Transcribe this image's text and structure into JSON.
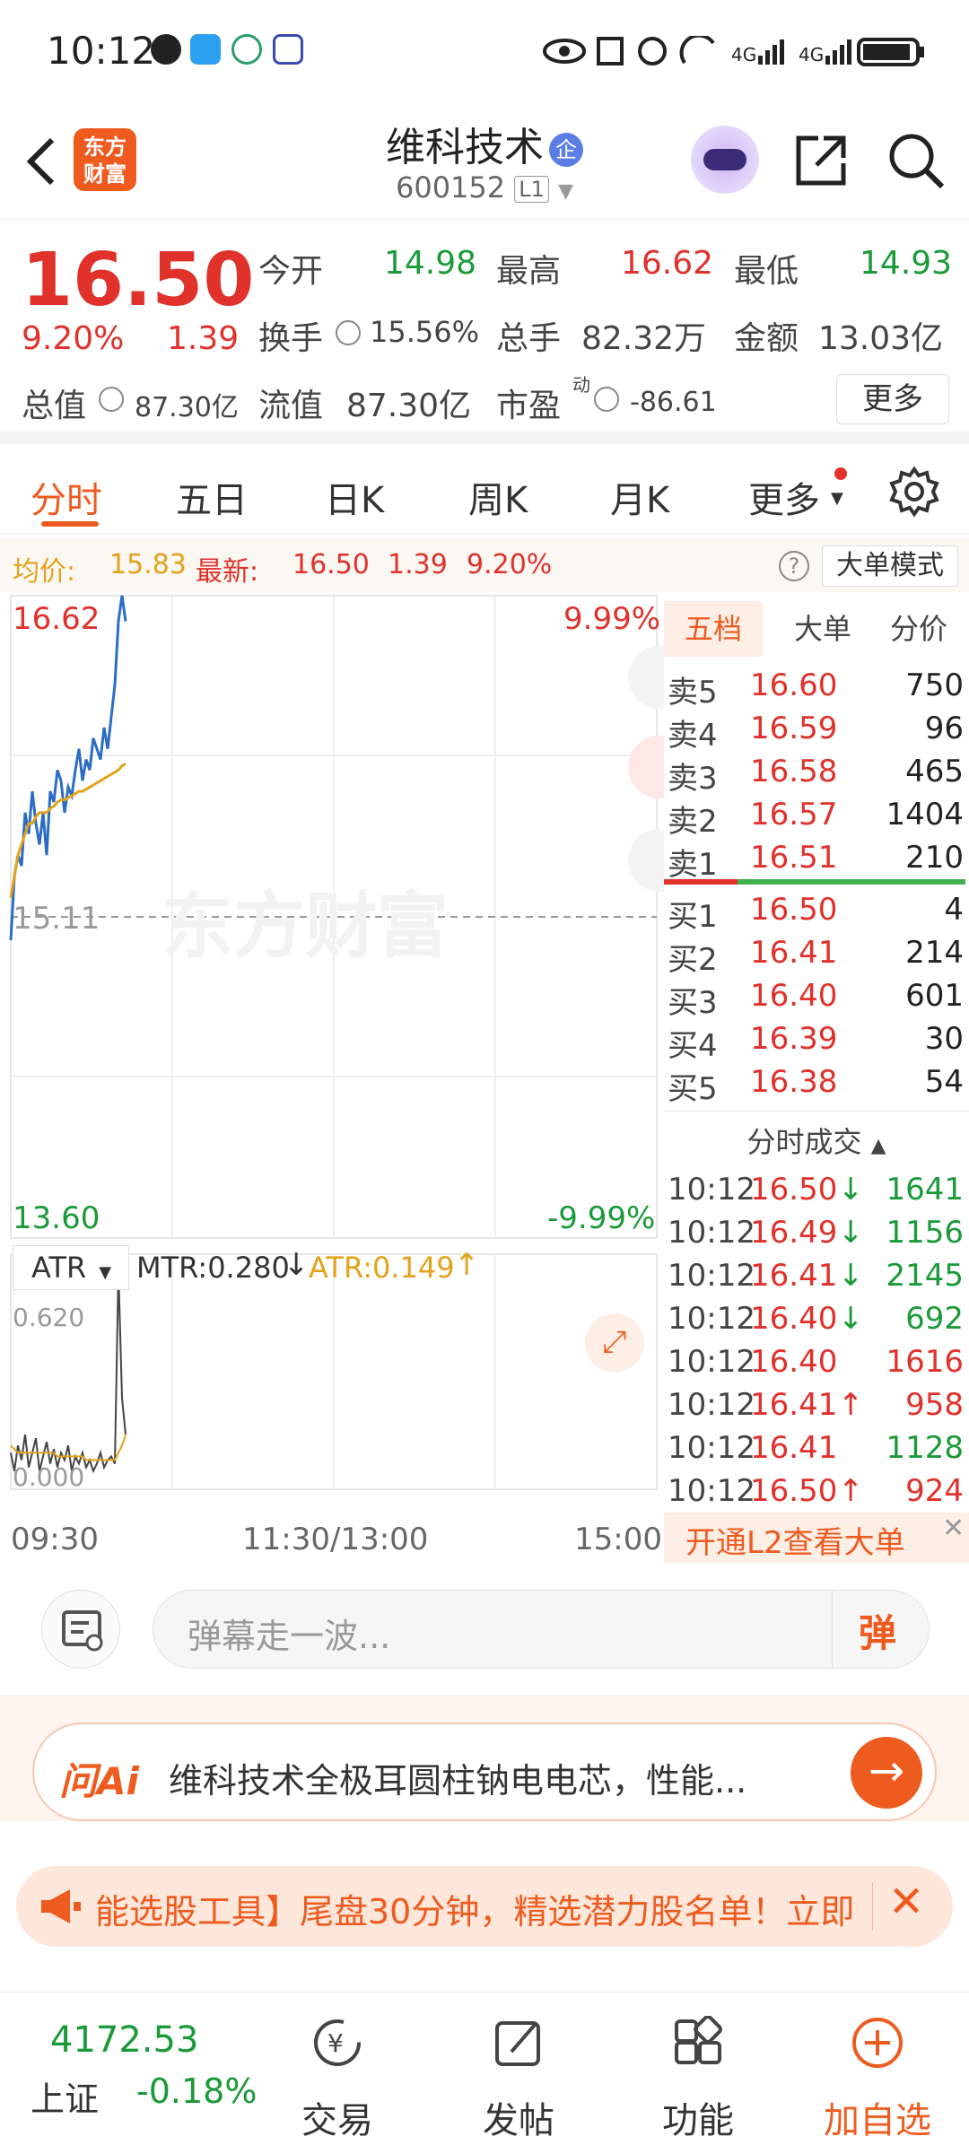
{
  "status": {
    "time": "10:12"
  },
  "header": {
    "logo_text": "东方财富",
    "stock_name": "维科技术",
    "badge": "企",
    "code": "600152",
    "level": "L1"
  },
  "quote": {
    "price": "16.50",
    "change_pct": "9.20%",
    "change": "1.39",
    "open_label": "今开",
    "open": "14.98",
    "high_label": "最高",
    "high": "16.62",
    "low_label": "最低",
    "low": "14.93",
    "turnover_label": "换手",
    "turnover": "15.56%",
    "volume_label": "总手",
    "volume": "82.32万",
    "amount_label": "金额",
    "amount": "13.03亿",
    "mktcap_label": "总值",
    "mktcap": "87.30亿",
    "float_label": "流值",
    "float": "87.30亿",
    "pe_label": "市盈",
    "pe_sup": "动",
    "pe": "-86.61",
    "more": "更多"
  },
  "tabs": [
    "分时",
    "五日",
    "日K",
    "周K",
    "月K",
    "更多"
  ],
  "avgbar": {
    "avg_label": "均价:",
    "avg": "15.83",
    "last_label": "最新:",
    "last": "16.50",
    "chg": "1.39",
    "pct": "9.20%",
    "mode": "大单模式"
  },
  "chart": {
    "top_price": "16.62",
    "top_pct": "9.99%",
    "mid_price": "15.11",
    "bottom_price": "13.60",
    "bottom_pct": "-9.99%",
    "watermark": "东方财富",
    "ind_name": "ATR",
    "mtr": "MTR:0.280",
    "atr": "ATR:0.149",
    "ind_top": "0.620",
    "ind_bottom": "0.000",
    "t_start": "09:30",
    "t_mid": "11:30/13:00",
    "t_end": "15:00",
    "price_series": [
      15.0,
      15.3,
      15.4,
      15.35,
      15.6,
      15.5,
      15.7,
      15.55,
      15.45,
      15.6,
      15.4,
      15.7,
      15.65,
      15.8,
      15.75,
      15.6,
      15.72,
      15.68,
      15.8,
      15.9,
      15.75,
      15.85,
      15.8,
      15.95,
      15.9,
      15.85,
      16.0,
      15.9,
      16.05,
      16.2,
      16.5,
      16.62,
      16.5
    ],
    "avg_series": [
      15.2,
      15.3,
      15.4,
      15.45,
      15.5,
      15.55,
      15.55,
      15.58,
      15.6,
      15.6,
      15.6,
      15.62,
      15.63,
      15.65,
      15.66,
      15.66,
      15.67,
      15.68,
      15.69,
      15.7,
      15.7,
      15.71,
      15.72,
      15.73,
      15.74,
      15.75,
      15.76,
      15.77,
      15.78,
      15.79,
      15.8,
      15.82,
      15.83
    ],
    "atr_series": [
      0.1,
      0.05,
      0.12,
      0.08,
      0.15,
      0.06,
      0.1,
      0.14,
      0.05,
      0.09,
      0.13,
      0.07,
      0.11,
      0.06,
      0.1,
      0.08,
      0.12,
      0.05,
      0.09,
      0.07,
      0.1,
      0.06,
      0.08,
      0.05,
      0.07,
      0.1,
      0.06,
      0.08,
      0.09,
      0.07,
      0.6,
      0.25,
      0.15
    ],
    "atr_avg_series": [
      0.12,
      0.11,
      0.1,
      0.1,
      0.1,
      0.1,
      0.1,
      0.1,
      0.1,
      0.1,
      0.1,
      0.1,
      0.1,
      0.09,
      0.09,
      0.09,
      0.09,
      0.09,
      0.09,
      0.09,
      0.09,
      0.08,
      0.08,
      0.08,
      0.08,
      0.08,
      0.08,
      0.08,
      0.08,
      0.08,
      0.1,
      0.12,
      0.149
    ]
  },
  "book": {
    "tabs": [
      "五档",
      "大单",
      "分价"
    ],
    "asks": [
      [
        "卖5",
        "16.60",
        "750"
      ],
      [
        "卖4",
        "16.59",
        "96"
      ],
      [
        "卖3",
        "16.58",
        "465"
      ],
      [
        "卖2",
        "16.57",
        "1404"
      ],
      [
        "卖1",
        "16.51",
        "210"
      ]
    ],
    "bids": [
      [
        "买1",
        "16.50",
        "4"
      ],
      [
        "买2",
        "16.41",
        "214"
      ],
      [
        "买3",
        "16.40",
        "601"
      ],
      [
        "买4",
        "16.39",
        "30"
      ],
      [
        "买5",
        "16.38",
        "54"
      ]
    ],
    "trades_title": "分时成交",
    "trades": [
      [
        "10:12",
        "16.50",
        "↓",
        "1641",
        "green"
      ],
      [
        "10:12",
        "16.49",
        "↓",
        "1156",
        "green"
      ],
      [
        "10:12",
        "16.41",
        "↓",
        "2145",
        "green"
      ],
      [
        "10:12",
        "16.40",
        "↓",
        "692",
        "green"
      ],
      [
        "10:12",
        "16.40",
        "",
        "1616",
        "red"
      ],
      [
        "10:12",
        "16.41",
        "↑",
        "958",
        "red"
      ],
      [
        "10:12",
        "16.41",
        "",
        "1128",
        "green"
      ],
      [
        "10:12",
        "16.50",
        "↑",
        "924",
        "red"
      ]
    ],
    "l2": "开通L2查看大单"
  },
  "danmu": {
    "placeholder": "弹幕走一波...",
    "btn": "弹"
  },
  "ai": {
    "logo": "问Ai",
    "text": "维科技术全极耳圆柱钠电电芯，性能..."
  },
  "notice": {
    "text": "能选股工具】尾盘30分钟，精选潜力股名单！立即"
  },
  "bottom": {
    "index_value": "4172.53",
    "index_name": "上证",
    "index_chg": "-0.18%",
    "items": [
      "交易",
      "发帖",
      "功能",
      "加自选"
    ]
  },
  "colors": {
    "accent": "#ee5b1f",
    "up": "#e0312b",
    "down": "#1a9a38",
    "line": "#2b6cc4",
    "avg": "#e3a21a"
  }
}
